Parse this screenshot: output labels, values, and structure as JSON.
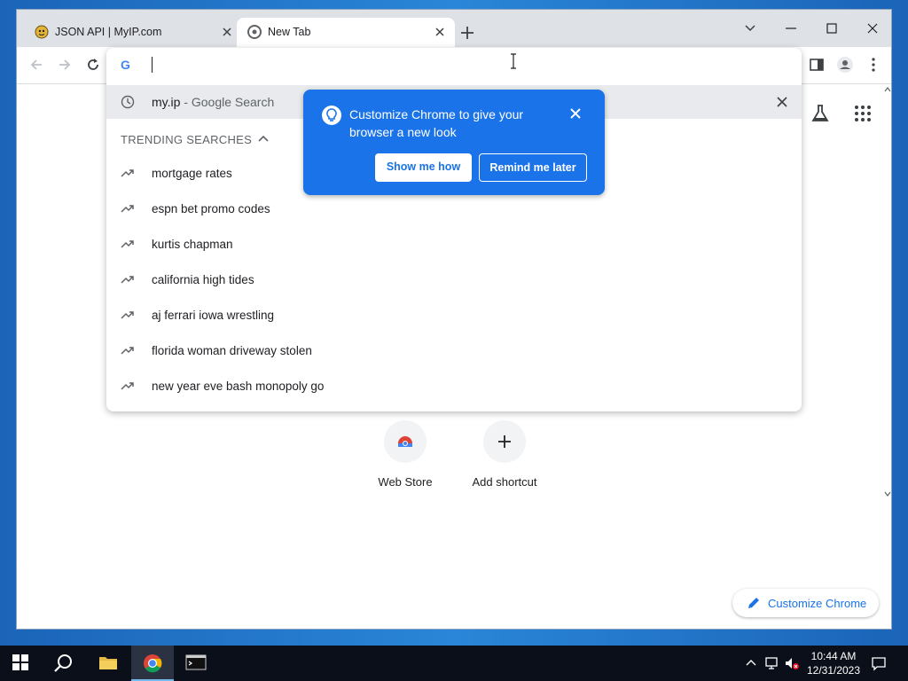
{
  "window": {
    "tabs": [
      {
        "title": "JSON API | MyIP.com",
        "active": false
      },
      {
        "title": "New Tab",
        "active": true
      }
    ]
  },
  "omnibox": {
    "placeholder": "",
    "suggestion": {
      "query": "my.ip",
      "suffix": " - Google Search"
    },
    "trending_header": "TRENDING SEARCHES",
    "trending": [
      "mortgage rates",
      "espn bet promo codes",
      "kurtis chapman",
      "california high tides",
      "aj ferrari iowa wrestling",
      "florida woman driveway stolen",
      "new year eve bash monopoly go"
    ]
  },
  "promo": {
    "text": "Customize Chrome to give your browser a new look",
    "show_label": "Show me how",
    "later_label": "Remind me later"
  },
  "ntp": {
    "shortcuts": [
      {
        "label": "Web Store"
      },
      {
        "label": "Add shortcut"
      }
    ],
    "customize_label": "Customize Chrome"
  },
  "taskbar": {
    "time": "10:44 AM",
    "date": "12/31/2023"
  },
  "colors": {
    "accent": "#1a73e8",
    "tabstrip": "#dee1e6",
    "taskbar": "#0a0f1a"
  }
}
